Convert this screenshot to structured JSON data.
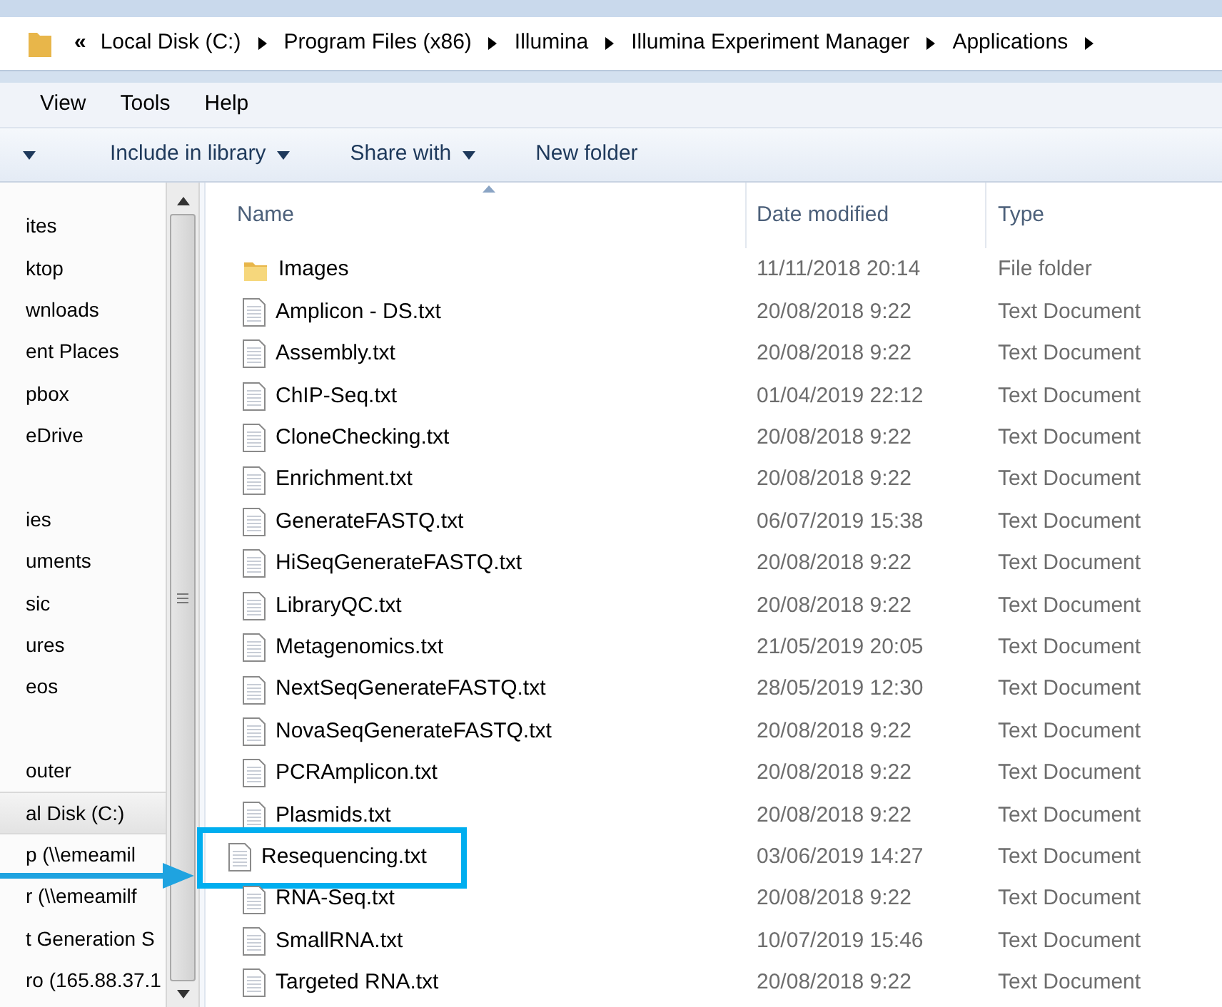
{
  "breadcrumb": {
    "overflow": "«",
    "parts": [
      "Local Disk (C:)",
      "Program Files (x86)",
      "Illumina",
      "Illumina Experiment Manager",
      "Applications"
    ]
  },
  "menu": [
    "View",
    "Tools",
    "Help"
  ],
  "toolbar": [
    {
      "label": "Include in library",
      "dropdown": true
    },
    {
      "label": "Share with",
      "dropdown": true
    },
    {
      "label": "New folder",
      "dropdown": false
    }
  ],
  "sidebar": {
    "groups": [
      {
        "items": [
          {
            "label": "ites",
            "selected": false
          },
          {
            "label": "ktop",
            "selected": false
          },
          {
            "label": "wnloads",
            "selected": false
          },
          {
            "label": "ent Places",
            "selected": false
          },
          {
            "label": "pbox",
            "selected": false
          },
          {
            "label": "eDrive",
            "selected": false
          }
        ]
      },
      {
        "items": [
          {
            "label": "ies",
            "selected": false
          },
          {
            "label": "uments",
            "selected": false
          },
          {
            "label": "sic",
            "selected": false
          },
          {
            "label": "ures",
            "selected": false
          },
          {
            "label": "eos",
            "selected": false
          }
        ]
      },
      {
        "items": [
          {
            "label": "outer",
            "selected": false
          },
          {
            "label": "al Disk (C:)",
            "selected": true
          },
          {
            "label": "p (\\\\emeamil",
            "selected": false
          },
          {
            "label": "r (\\\\emeamilf",
            "selected": false
          },
          {
            "label": "t Generation S",
            "selected": false
          },
          {
            "label": "ro (165.88.37.1",
            "selected": false
          }
        ]
      }
    ]
  },
  "table": {
    "columns": [
      "Name",
      "Date modified",
      "Type"
    ],
    "rows": [
      {
        "kind": "folder",
        "name": "Images",
        "date": "11/11/2018 20:14",
        "type": "File folder",
        "highlighted": false
      },
      {
        "kind": "file",
        "name": "Amplicon - DS.txt",
        "date": "20/08/2018 9:22",
        "type": "Text Document",
        "highlighted": false
      },
      {
        "kind": "file",
        "name": "Assembly.txt",
        "date": "20/08/2018 9:22",
        "type": "Text Document",
        "highlighted": false
      },
      {
        "kind": "file",
        "name": "ChIP-Seq.txt",
        "date": "01/04/2019 22:12",
        "type": "Text Document",
        "highlighted": false
      },
      {
        "kind": "file",
        "name": "CloneChecking.txt",
        "date": "20/08/2018 9:22",
        "type": "Text Document",
        "highlighted": false
      },
      {
        "kind": "file",
        "name": "Enrichment.txt",
        "date": "20/08/2018 9:22",
        "type": "Text Document",
        "highlighted": false
      },
      {
        "kind": "file",
        "name": "GenerateFASTQ.txt",
        "date": "06/07/2019 15:38",
        "type": "Text Document",
        "highlighted": false
      },
      {
        "kind": "file",
        "name": "HiSeqGenerateFASTQ.txt",
        "date": "20/08/2018 9:22",
        "type": "Text Document",
        "highlighted": false
      },
      {
        "kind": "file",
        "name": "LibraryQC.txt",
        "date": "20/08/2018 9:22",
        "type": "Text Document",
        "highlighted": false
      },
      {
        "kind": "file",
        "name": "Metagenomics.txt",
        "date": "21/05/2019 20:05",
        "type": "Text Document",
        "highlighted": false
      },
      {
        "kind": "file",
        "name": "NextSeqGenerateFASTQ.txt",
        "date": "28/05/2019 12:30",
        "type": "Text Document",
        "highlighted": false
      },
      {
        "kind": "file",
        "name": "NovaSeqGenerateFASTQ.txt",
        "date": "20/08/2018 9:22",
        "type": "Text Document",
        "highlighted": false
      },
      {
        "kind": "file",
        "name": "PCRAmplicon.txt",
        "date": "20/08/2018 9:22",
        "type": "Text Document",
        "highlighted": false
      },
      {
        "kind": "file",
        "name": "Plasmids.txt",
        "date": "20/08/2018 9:22",
        "type": "Text Document",
        "highlighted": false
      },
      {
        "kind": "file",
        "name": "Resequencing.txt",
        "date": "03/06/2019 14:27",
        "type": "Text Document",
        "highlighted": true
      },
      {
        "kind": "file",
        "name": "RNA-Seq.txt",
        "date": "20/08/2018 9:22",
        "type": "Text Document",
        "highlighted": false
      },
      {
        "kind": "file",
        "name": "SmallRNA.txt",
        "date": "10/07/2019 15:46",
        "type": "Text Document",
        "highlighted": false
      },
      {
        "kind": "file",
        "name": "Targeted RNA.txt",
        "date": "20/08/2018 9:22",
        "type": "Text Document",
        "highlighted": false
      }
    ]
  }
}
